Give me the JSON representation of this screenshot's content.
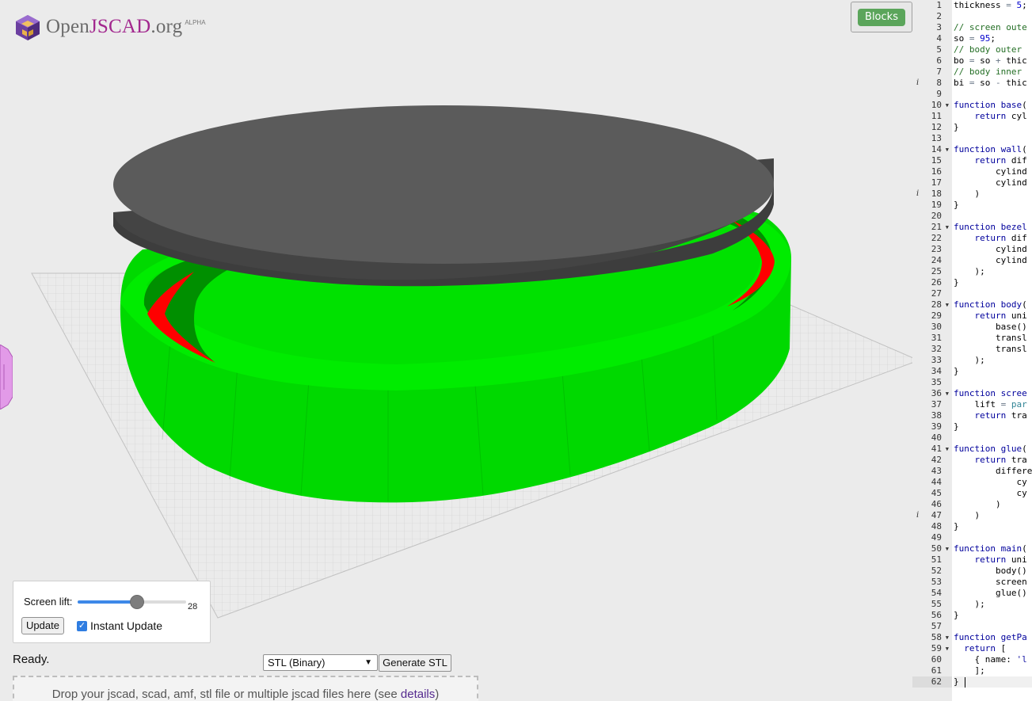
{
  "app": {
    "logo_brand_prefix": "Open",
    "logo_brand_js": "JSCAD",
    "logo_brand_suffix": ".org",
    "logo_badge": "ALPHA",
    "blocks_button": "Blocks"
  },
  "parameters": {
    "screen_lift_label": "Screen lift:",
    "screen_lift_value": "28",
    "screen_lift_fraction": 0.55,
    "update_button": "Update",
    "instant_update_label": "Instant Update",
    "instant_update_checked": true
  },
  "status": "Ready.",
  "export": {
    "format_selected": "STL (Binary)",
    "generate_button": "Generate STL"
  },
  "dropzone": {
    "text": "Drop your jscad, scad, amf, stl file or multiple jscad files here (see ",
    "link": "details",
    "suffix": ")"
  },
  "colors": {
    "body": "#00e600",
    "lid": "#595959",
    "glue": "#ff0000",
    "accent_purple": "#a2278e"
  },
  "editor": {
    "lines": [
      {
        "n": "1",
        "html": "thickness = 5;"
      },
      {
        "n": "2",
        "html": ""
      },
      {
        "n": "3",
        "html": "// screen oute"
      },
      {
        "n": "4",
        "html": "so = 95;"
      },
      {
        "n": "5",
        "html": "// body outer"
      },
      {
        "n": "6",
        "html": "bo = so + thic"
      },
      {
        "n": "7",
        "html": "// body inner"
      },
      {
        "n": "8",
        "html": "bi = so - thic",
        "info": true
      },
      {
        "n": "9",
        "html": ""
      },
      {
        "n": "10",
        "html": "function base(",
        "fold": true
      },
      {
        "n": "11",
        "html": "    return cyl"
      },
      {
        "n": "12",
        "html": "}"
      },
      {
        "n": "13",
        "html": ""
      },
      {
        "n": "14",
        "html": "function wall(",
        "fold": true
      },
      {
        "n": "15",
        "html": "    return dif"
      },
      {
        "n": "16",
        "html": "        cylind"
      },
      {
        "n": "17",
        "html": "        cylind"
      },
      {
        "n": "18",
        "html": "    )",
        "info": true
      },
      {
        "n": "19",
        "html": "}"
      },
      {
        "n": "20",
        "html": ""
      },
      {
        "n": "21",
        "html": "function bezel",
        "fold": true
      },
      {
        "n": "22",
        "html": "    return dif"
      },
      {
        "n": "23",
        "html": "        cylind"
      },
      {
        "n": "24",
        "html": "        cylind"
      },
      {
        "n": "25",
        "html": "    );"
      },
      {
        "n": "26",
        "html": "}"
      },
      {
        "n": "27",
        "html": ""
      },
      {
        "n": "28",
        "html": "function body(",
        "fold": true
      },
      {
        "n": "29",
        "html": "    return uni"
      },
      {
        "n": "30",
        "html": "        base()"
      },
      {
        "n": "31",
        "html": "        transl"
      },
      {
        "n": "32",
        "html": "        transl"
      },
      {
        "n": "33",
        "html": "    );"
      },
      {
        "n": "34",
        "html": "}"
      },
      {
        "n": "35",
        "html": ""
      },
      {
        "n": "36",
        "html": "function scree",
        "fold": true
      },
      {
        "n": "37",
        "html": "    lift = par"
      },
      {
        "n": "38",
        "html": "    return tra"
      },
      {
        "n": "39",
        "html": "}"
      },
      {
        "n": "40",
        "html": ""
      },
      {
        "n": "41",
        "html": "function glue(",
        "fold": true
      },
      {
        "n": "42",
        "html": "    return tra"
      },
      {
        "n": "43",
        "html": "        differe"
      },
      {
        "n": "44",
        "html": "            cy"
      },
      {
        "n": "45",
        "html": "            cy"
      },
      {
        "n": "46",
        "html": "        )"
      },
      {
        "n": "47",
        "html": "    )",
        "info": true
      },
      {
        "n": "48",
        "html": "}"
      },
      {
        "n": "49",
        "html": ""
      },
      {
        "n": "50",
        "html": "function main(",
        "fold": true
      },
      {
        "n": "51",
        "html": "    return uni"
      },
      {
        "n": "52",
        "html": "        body()"
      },
      {
        "n": "53",
        "html": "        screen"
      },
      {
        "n": "54",
        "html": "        glue()"
      },
      {
        "n": "55",
        "html": "    );"
      },
      {
        "n": "56",
        "html": "}"
      },
      {
        "n": "57",
        "html": ""
      },
      {
        "n": "58",
        "html": "function getPa",
        "fold": true
      },
      {
        "n": "59",
        "html": "  return [",
        "fold": true
      },
      {
        "n": "60",
        "html": "    { name: 'l"
      },
      {
        "n": "61",
        "html": "    ];"
      },
      {
        "n": "62",
        "html": "} ",
        "active": true
      }
    ]
  }
}
